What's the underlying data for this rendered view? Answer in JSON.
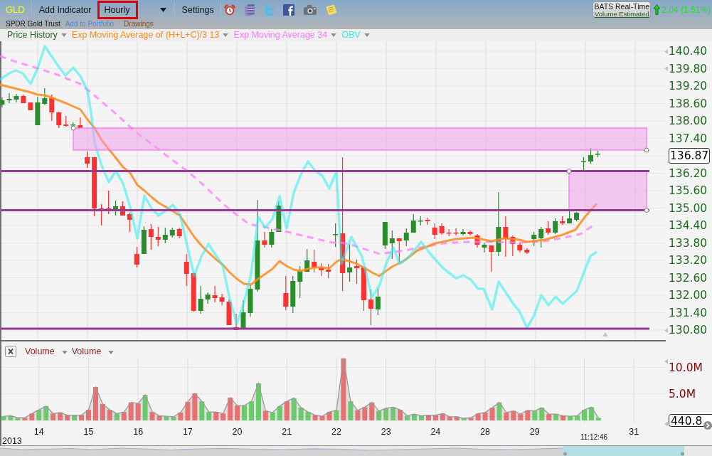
{
  "toolbar": {
    "symbol": "GLD",
    "items": [
      {
        "kind": "button",
        "label": "Add Indicator",
        "highlighted": false
      },
      {
        "kind": "button",
        "label": "Hourly",
        "highlighted": true
      },
      {
        "kind": "menu",
        "highlighted": false
      },
      {
        "kind": "button",
        "label": "Settings",
        "highlighted": false
      }
    ],
    "feed": {
      "title": "BATS Real-Time",
      "note": "Volume Estimated"
    },
    "change": {
      "text": "2.04 (1.51%)",
      "rising": true
    }
  },
  "subheader": {
    "name": "SPDR Gold Trust",
    "links": [
      {
        "label": "Add to Portfolio",
        "kind": "link"
      },
      {
        "label": "Drawings",
        "kind": "menu"
      }
    ]
  },
  "price_panel": {
    "legend": [
      {
        "label": "Price History",
        "color": "#1f6b1f"
      },
      {
        "label": "Exp Moving Average of (H+L+C)/3 13",
        "color": "#ff8a1c"
      },
      {
        "label": "Exp Moving Average 34",
        "color": "#ff7cff"
      },
      {
        "label": "OBV",
        "color": "#2eeeee"
      }
    ],
    "axis": [
      {
        "label": "140.40",
        "kind": "tick",
        "marker": true
      },
      {
        "label": "139.80",
        "kind": "tick",
        "marker": true
      },
      {
        "label": "139.20",
        "kind": "tick",
        "marker": false
      },
      {
        "label": "138.60",
        "kind": "tick",
        "marker": false
      },
      {
        "label": "138.00",
        "kind": "tick",
        "marker": false
      },
      {
        "label": "137.40",
        "kind": "tick",
        "marker": false
      },
      {
        "label": "136.87",
        "kind": "last",
        "marker": false
      },
      {
        "label": "136.20",
        "kind": "tick",
        "marker": false
      },
      {
        "label": "135.60",
        "kind": "tick",
        "marker": false
      },
      {
        "label": "135.00",
        "kind": "tick",
        "marker": false
      },
      {
        "label": "134.40",
        "kind": "tick",
        "marker": false
      },
      {
        "label": "133.80",
        "kind": "tick",
        "marker": false
      },
      {
        "label": "133.20",
        "kind": "tick",
        "marker": false
      },
      {
        "label": "132.60",
        "kind": "tick",
        "marker": false
      },
      {
        "label": "132.00",
        "kind": "tick",
        "marker": false
      },
      {
        "label": "131.40",
        "kind": "tick",
        "marker": false
      },
      {
        "label": "130.80",
        "kind": "tick",
        "marker": true
      }
    ]
  },
  "volume_panel": {
    "current_value": "440.8",
    "time_label": "11:12:46",
    "year_label": "2013",
    "chart_data": {
      "type": "bar",
      "grid": true,
      "categories": [
        null,
        null,
        null,
        null,
        null,
        "14",
        null,
        null,
        null,
        null,
        null,
        null,
        "15",
        null,
        null,
        null,
        null,
        null,
        null,
        "16",
        null,
        null,
        null,
        null,
        null,
        null,
        "17",
        null,
        null,
        null,
        null,
        null,
        null,
        "20",
        null,
        null,
        null,
        null,
        null,
        null,
        "21",
        null,
        null,
        null,
        null,
        null,
        null,
        "22",
        null,
        null,
        null,
        null,
        null,
        null,
        "23",
        null,
        null,
        null,
        null,
        null,
        null,
        "24",
        null,
        null,
        null,
        null,
        null,
        null,
        "28",
        null,
        null,
        null,
        null,
        null,
        null,
        "29",
        null,
        null,
        null,
        null,
        null,
        null,
        null,
        null,
        null,
        null,
        null,
        null,
        null,
        "31",
        null,
        null,
        null,
        null
      ],
      "ylim": [
        0,
        11.8
      ],
      "yticks": [
        {
          "value": 5,
          "label": "5.0M"
        },
        {
          "value": 10,
          "label": "10.0M"
        }
      ],
      "series": [
        {
          "name": "Volume",
          "color": "#6cc96c",
          "values": [
            0.8,
            0.9,
            0.5,
            null,
            null,
            2.0,
            2.7,
            null,
            null,
            null,
            1.0,
            null,
            null,
            null,
            null,
            null,
            1.3,
            null,
            null,
            null,
            4.8,
            null,
            null,
            0.8,
            0.7,
            null,
            null,
            null,
            3.6,
            1.6,
            null,
            null,
            null,
            null,
            2.8,
            3.6,
            7.0,
            null,
            1.5,
            2.7,
            null,
            4.2,
            2.4,
            1.6,
            null,
            null,
            null,
            1.9,
            null,
            3.6,
            null,
            null,
            null,
            1.8,
            2.3,
            2.5,
            null,
            0.9,
            1.2,
            0.9,
            null,
            null,
            null,
            null,
            null,
            0.4,
            null,
            null,
            null,
            null,
            3.4,
            null,
            null,
            null,
            null,
            1.8,
            2.4,
            null,
            1.2,
            null,
            0.8,
            0.9,
            2.0,
            2.5,
            0.5,
            null,
            null,
            null,
            null,
            null,
            null,
            null,
            null,
            null
          ]
        },
        {
          "color": "#e87070",
          "values": [
            null,
            null,
            null,
            0.5,
            1.3,
            null,
            null,
            1.3,
            1.5,
            1.0,
            null,
            1.0,
            2.0,
            6.3,
            3.1,
            2.0,
            null,
            1.6,
            3.4,
            3.2,
            null,
            1.6,
            0.9,
            null,
            null,
            1.5,
            3.5,
            5.1,
            null,
            null,
            1.6,
            1.3,
            4.3,
            2.8,
            null,
            null,
            null,
            1.8,
            null,
            null,
            3.6,
            null,
            null,
            null,
            1.0,
            0.8,
            1.6,
            null,
            11.7,
            null,
            1.9,
            2.5,
            3.4,
            null,
            null,
            null,
            2.0,
            null,
            null,
            null,
            1.0,
            1.0,
            1.3,
            0.7,
            0.7,
            null,
            0.5,
            1.3,
            1.5,
            2.4,
            null,
            1.5,
            1.8,
            1.2,
            1.9,
            null,
            null,
            1.2,
            null,
            0.9,
            null,
            null,
            null,
            null,
            null,
            null,
            null,
            null,
            null,
            null,
            null,
            null,
            null,
            null
          ]
        },
        {
          "name": "Volume",
          "type": "area",
          "color": "#9a9a9a",
          "values": [
            0.8,
            0.9,
            0.5,
            0.5,
            1.3,
            2.0,
            2.7,
            1.3,
            1.5,
            1.0,
            1.0,
            1.0,
            2.0,
            6.3,
            3.1,
            2.0,
            1.3,
            1.6,
            3.4,
            3.2,
            4.8,
            1.6,
            0.9,
            0.8,
            0.7,
            1.5,
            3.5,
            5.1,
            3.6,
            1.6,
            1.6,
            1.3,
            4.3,
            2.8,
            2.8,
            3.6,
            7.0,
            1.8,
            1.5,
            2.7,
            3.6,
            4.2,
            2.4,
            1.6,
            1.0,
            0.8,
            1.6,
            1.9,
            11.7,
            3.6,
            1.9,
            2.5,
            3.4,
            1.8,
            2.3,
            2.5,
            2.0,
            0.9,
            1.2,
            0.9,
            1.0,
            1.0,
            1.3,
            0.7,
            0.7,
            0.4,
            0.5,
            1.3,
            1.5,
            2.4,
            3.4,
            1.5,
            1.8,
            1.2,
            1.9,
            1.8,
            2.4,
            1.2,
            1.2,
            0.9,
            0.8,
            0.9,
            2.0,
            2.5,
            0.5,
            null,
            null,
            null,
            null,
            null,
            null,
            null,
            null,
            null
          ]
        }
      ]
    }
  }
}
